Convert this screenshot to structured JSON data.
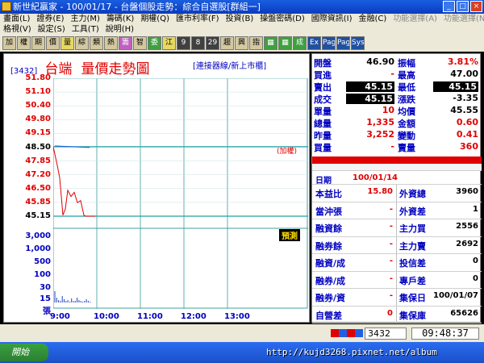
{
  "window": {
    "title": "新世紀贏家 - 100/01/17 - 台盤個股走勢：綜合自選股[群組一]"
  },
  "menu": {
    "row1": [
      "畫面(L)",
      "證券(E)",
      "主力(M)",
      "籌碼(K)",
      "期權(Q)",
      "匯市利率(F)",
      "投資(B)",
      "操盤密碼(D)",
      "國際資訊(I)",
      "金融(C)",
      "功能選擇(A)",
      "功能選擇(N)"
    ],
    "row2": [
      "格視(V)",
      "設定(S)",
      "工具(T)",
      "說明(H)"
    ]
  },
  "toolbar": [
    "加",
    "權",
    "期",
    "價",
    "量",
    "綜",
    "類",
    "熱",
    "籌",
    "智",
    "委",
    "江",
    "9",
    "8",
    "29",
    "趨",
    "興",
    "指",
    "▦",
    "▦",
    "成",
    "Ex",
    "Page",
    "Page",
    "Sys"
  ],
  "stock": {
    "code": "[3432]",
    "name": "台端",
    "chart_title": "量價走勢圖",
    "subtitle": "[連接器線/新上市櫃]"
  },
  "chart_data": {
    "type": "line",
    "x_ticks": [
      "9:00",
      "10:00",
      "11:00",
      "12:00",
      "13:00"
    ],
    "y_ticks": [
      "51.80",
      "51.10",
      "50.40",
      "49.80",
      "49.15",
      "48.50",
      "47.85",
      "47.20",
      "46.50",
      "45.85",
      "45.15"
    ],
    "vol_ticks": [
      "3,000",
      "1,000",
      "500",
      "100",
      "30",
      "15",
      "張"
    ],
    "limit_label": "(加權)",
    "volume_tag": "預測",
    "reference_price": 48.5,
    "price_series": [
      [
        0,
        48.5
      ],
      [
        5,
        47.6
      ],
      [
        8,
        47.0
      ],
      [
        12,
        45.2
      ],
      [
        15,
        45.5
      ],
      [
        18,
        46.4
      ],
      [
        22,
        46.1
      ],
      [
        26,
        46.3
      ],
      [
        30,
        45.8
      ],
      [
        34,
        45.9
      ],
      [
        38,
        45.2
      ],
      [
        40,
        45.15
      ],
      [
        44,
        45.15
      ],
      [
        48,
        45.15
      ],
      [
        52,
        45.15
      ]
    ],
    "limit_up": 51.8,
    "limit_down": 45.15
  },
  "quote": {
    "left": [
      {
        "label": "開盤",
        "value": "46.90",
        "color": "#000",
        "box": false
      },
      {
        "label": "買進",
        "value": "-",
        "color": "#e00000",
        "box": false
      },
      {
        "label": "賣出",
        "value": "45.15",
        "color": "#fff",
        "box": true
      },
      {
        "label": "成交",
        "value": "45.15",
        "color": "#fff",
        "box": true
      },
      {
        "label": "單量",
        "value": "10",
        "color": "#e00000",
        "box": false
      },
      {
        "label": "總量",
        "value": "1,335",
        "color": "#e00000",
        "box": false
      },
      {
        "label": "昨量",
        "value": "3,252",
        "color": "#e00000",
        "box": false
      },
      {
        "label": "買量",
        "value": "-",
        "color": "#e00000",
        "box": false
      }
    ],
    "right": [
      {
        "label": "振幅",
        "value": "3.81%",
        "color": "#e00000",
        "box": false
      },
      {
        "label": "最高",
        "value": "47.00",
        "color": "#000",
        "box": false
      },
      {
        "label": "最低",
        "value": "45.15",
        "color": "#fff",
        "box": true
      },
      {
        "label": "漲跌",
        "value": "-3.35",
        "color": "#000",
        "box": false
      },
      {
        "label": "均價",
        "value": "45.55",
        "color": "#000",
        "box": false
      },
      {
        "label": "金額",
        "value": "0.60",
        "color": "#e00000",
        "box": false
      },
      {
        "label": "變動",
        "value": "0.41",
        "color": "#e00000",
        "box": false
      },
      {
        "label": "賣量",
        "value": "360",
        "color": "#e00000",
        "box": false
      }
    ]
  },
  "date": {
    "label": "日期",
    "value": "100/01/14"
  },
  "fund": [
    {
      "a": "本益比",
      "b": "15.80",
      "c": "外資總",
      "d": "3960"
    },
    {
      "a": "當沖張",
      "b": "-",
      "c": "外資差",
      "d": "1"
    },
    {
      "a": "融資餘",
      "b": "-",
      "c": "主力買",
      "d": "2556"
    },
    {
      "a": "融券餘",
      "b": "-",
      "c": "主力賣",
      "d": "2692"
    },
    {
      "a": "融資/成",
      "b": "-",
      "c": "投信差",
      "d": "0"
    },
    {
      "a": "融券/成",
      "b": "-",
      "c": "專戶差",
      "d": "0"
    },
    {
      "a": "融券/資",
      "b": "-",
      "c": "集保日",
      "d": "100/01/07"
    },
    {
      "a": "自營差",
      "b": "0",
      "c": "集保庫",
      "d": "65626"
    }
  ],
  "status": {
    "code": "3432",
    "time": "09:48:37"
  },
  "taskbar": {
    "start": "開始"
  },
  "watermark": "http://kujd3268.pixnet.net/album"
}
